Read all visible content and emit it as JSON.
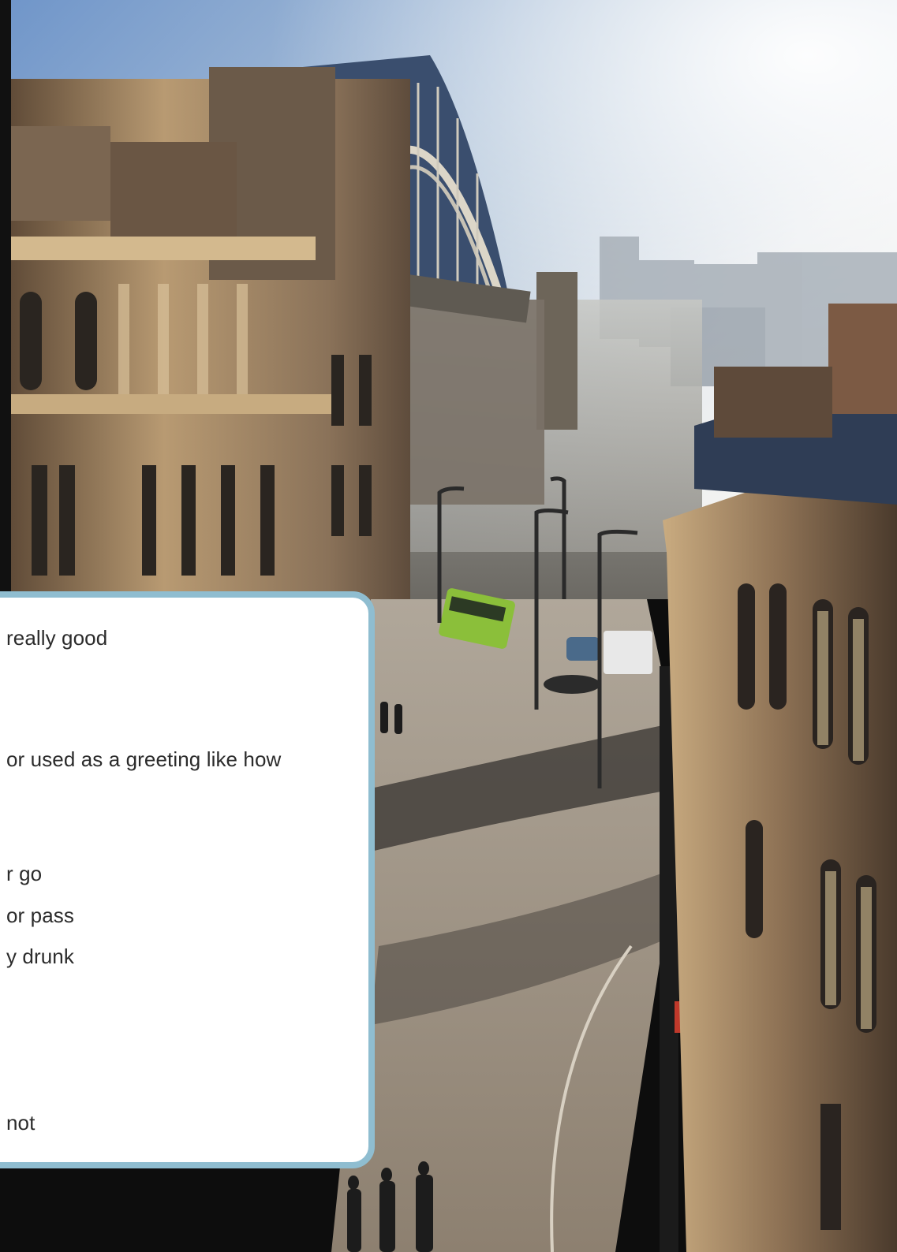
{
  "photo": {
    "scene": "city-street-with-arch-bridge",
    "palette": {
      "sky_top": "#6f95c9",
      "sky_haze": "#e9ecef",
      "stone_light": "#c9ab80",
      "stone_dark": "#4a3a2c",
      "bridge": "#3a4e6e",
      "bus": "#8bbf3a",
      "shadow": "#1e1c1b"
    }
  },
  "card": {
    "border_color": "#8fbdd0",
    "background": "#ffffff",
    "lines": [
      "really good",
      " or used as a greeting like how",
      "r go",
      "or pass",
      "y drunk",
      "not"
    ]
  }
}
